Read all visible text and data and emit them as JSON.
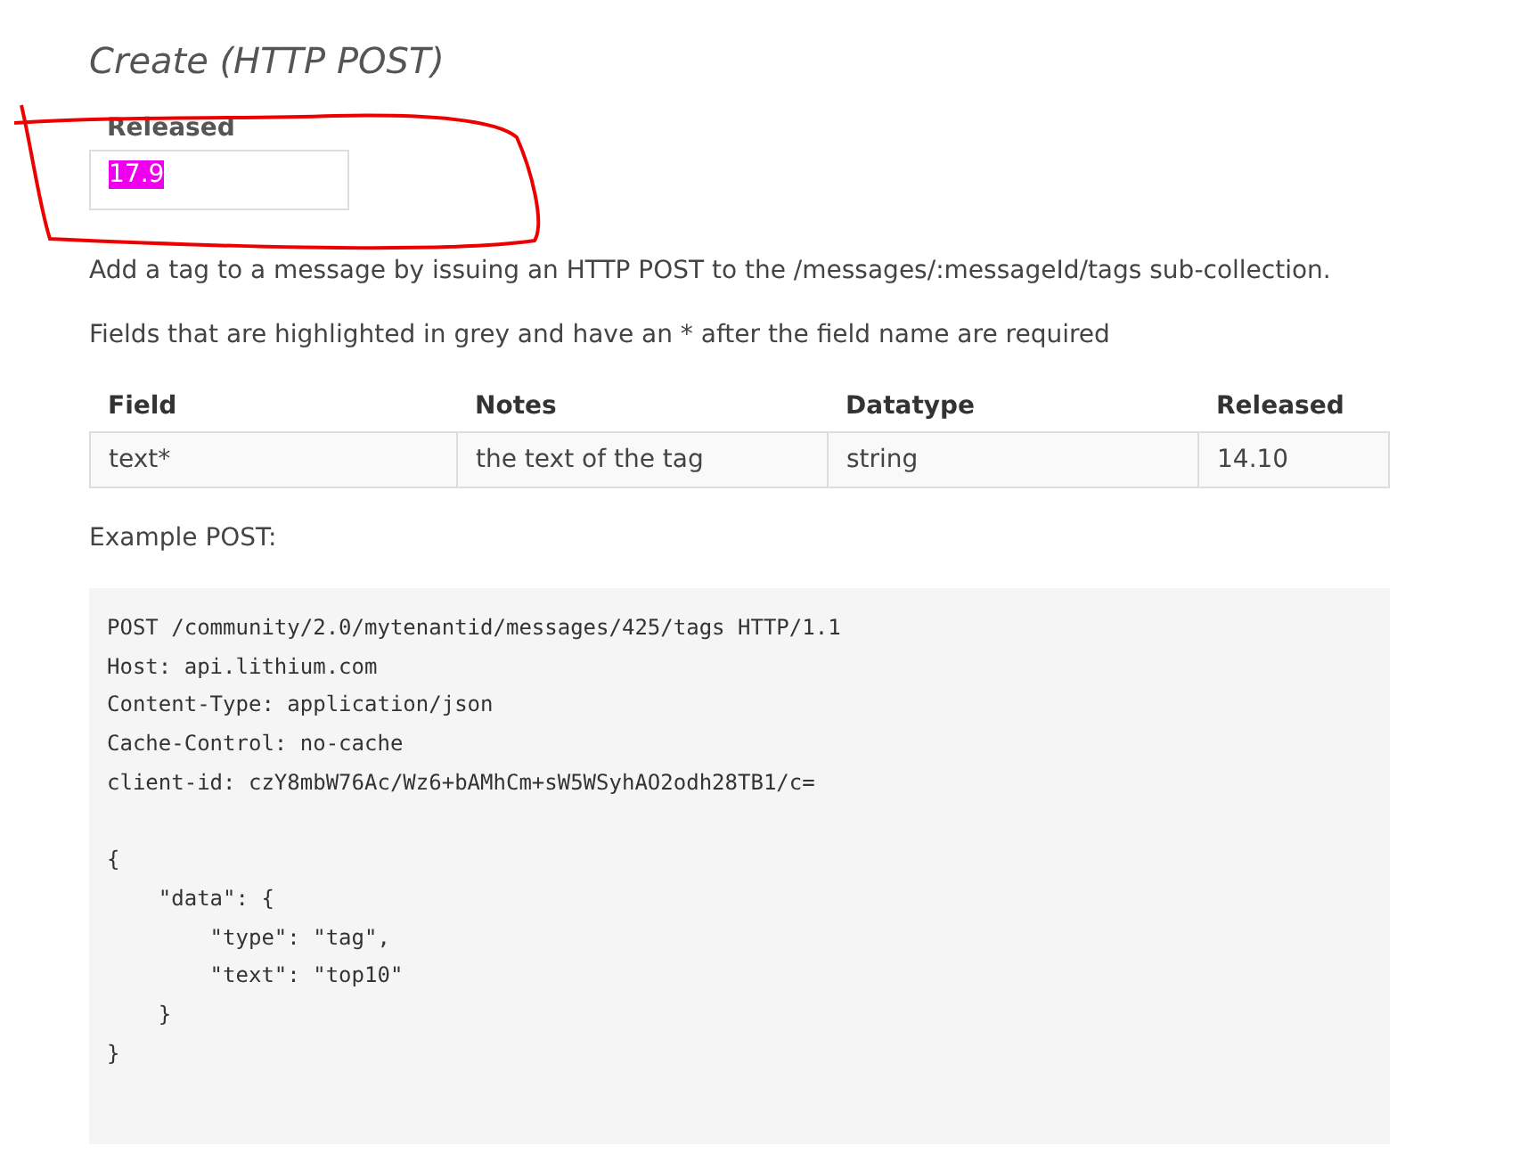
{
  "heading": "Create (HTTP POST)",
  "released_field": {
    "label": "Released",
    "value": "17.9",
    "highlighted": true
  },
  "intro": "Add a tag to a message by issuing an HTTP POST to the /messages/:messageId/tags sub-collection.",
  "note": "Fields that are highlighted in grey and have an * after the field name are required",
  "table": {
    "columns": [
      "Field",
      "Notes",
      "Datatype",
      "Released"
    ],
    "rows": [
      [
        "text*",
        "the text of the tag",
        "string",
        "14.10"
      ]
    ]
  },
  "example_label": "Example POST:",
  "code_blocks": [
    [
      "POST /community/2.0/mytenantid/messages/425/tags HTTP/1.1",
      "Host: api.lithium.com",
      "Content-Type: application/json",
      "Cache-Control: no-cache",
      "client-id: czY8mbW76Ac/Wz6+bAMhCm+sW5WSyhAO2odh28TB1/c="
    ],
    [
      "{",
      "    \"data\": {",
      "        \"type\": \"tag\",",
      "        \"text\": \"top10\"",
      "    }",
      "}"
    ]
  ]
}
